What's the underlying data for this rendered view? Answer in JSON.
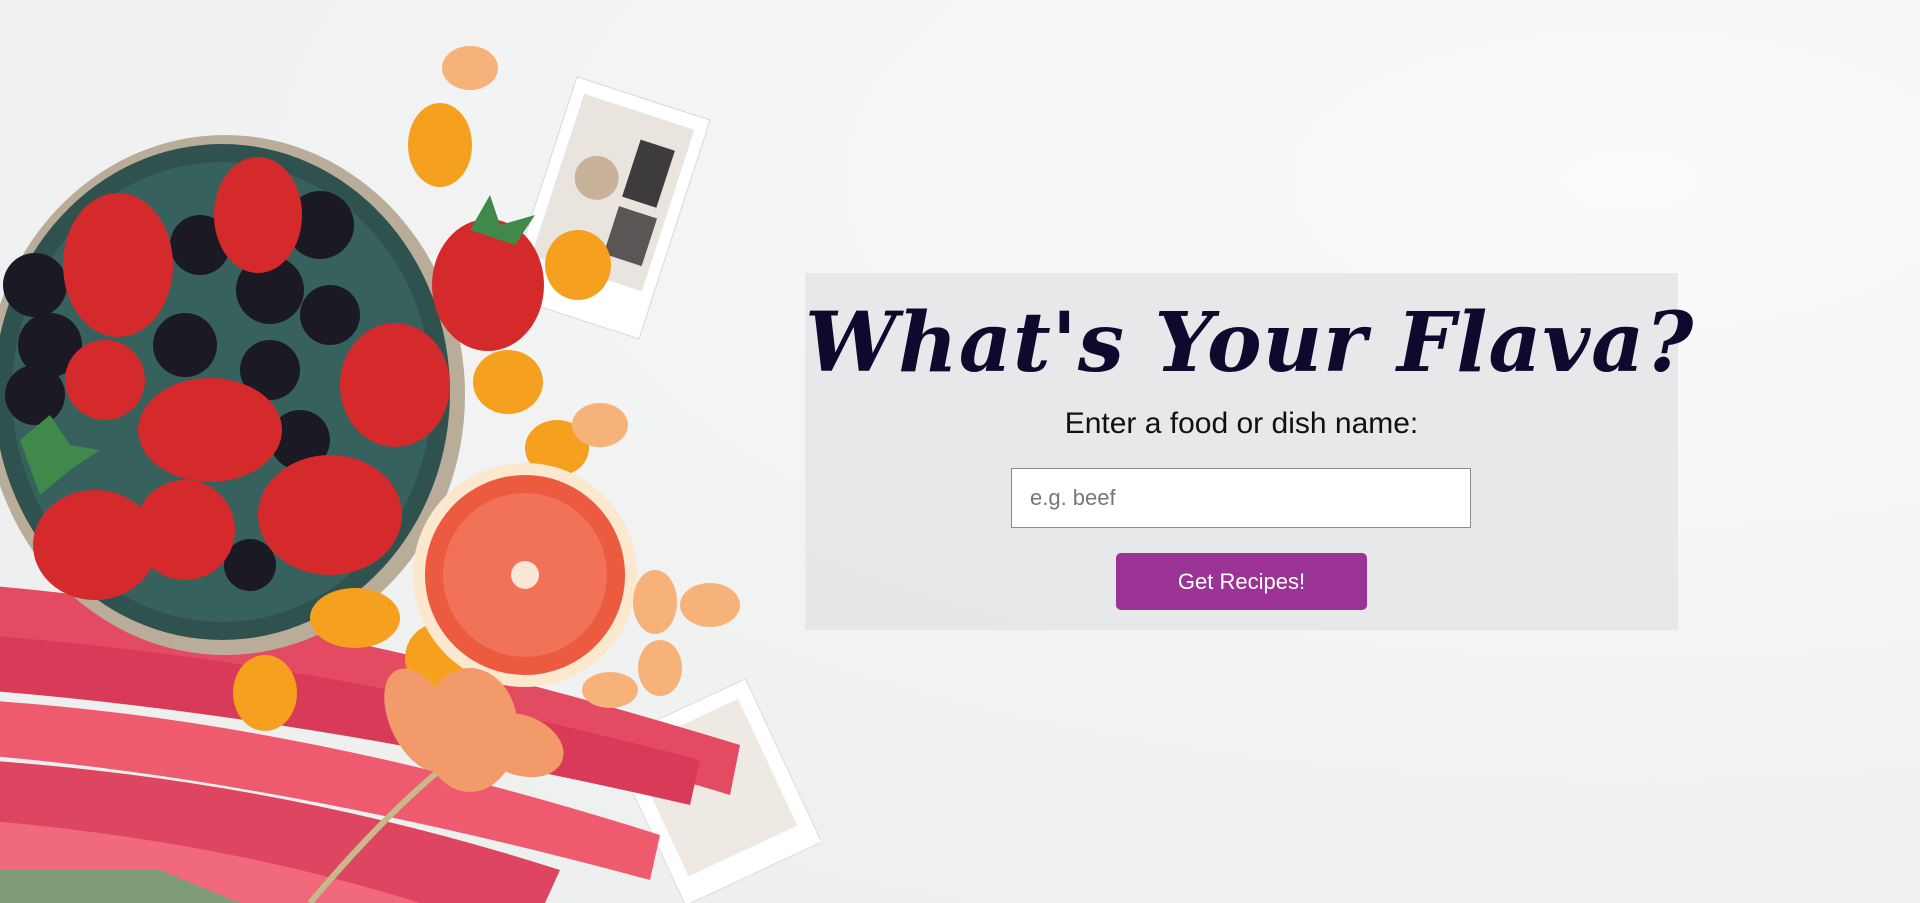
{
  "page": {
    "headline": "What's Your Flava?",
    "prompt": "Enter a food or dish name:"
  },
  "search": {
    "value": "",
    "placeholder": "e.g. beef"
  },
  "actions": {
    "submit_label": "Get Recipes!"
  },
  "colors": {
    "accent": "#9a3393",
    "headline": "#0e0a2e",
    "panel": "#e4e5e6"
  },
  "decor": {
    "background_image": "fruit-and-rhubarb-photo"
  }
}
